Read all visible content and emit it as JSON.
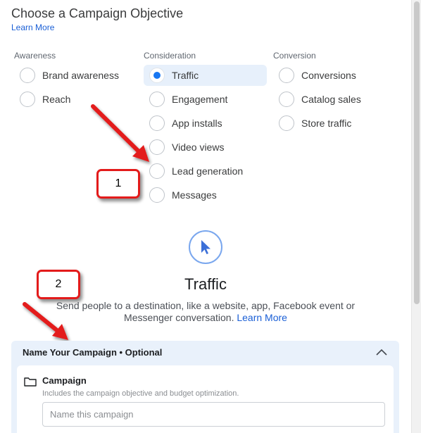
{
  "header": {
    "title": "Choose a Campaign Objective",
    "learn_more": "Learn More"
  },
  "columns": [
    {
      "header": "Awareness",
      "options": [
        "Brand awareness",
        "Reach"
      ]
    },
    {
      "header": "Consideration",
      "options": [
        "Traffic",
        "Engagement",
        "App installs",
        "Video views",
        "Lead generation",
        "Messages"
      ]
    },
    {
      "header": "Conversion",
      "options": [
        "Conversions",
        "Catalog sales",
        "Store traffic"
      ]
    }
  ],
  "selected_option": "Traffic",
  "callouts": {
    "one": "1",
    "two": "2"
  },
  "objective": {
    "icon": "cursor-pointer-icon",
    "title": "Traffic",
    "description": "Send people to a destination, like a website, app, Facebook event or Messenger conversation.",
    "learn_more": "Learn More"
  },
  "name_panel": {
    "title": "Name Your Campaign • Optional",
    "campaign_label": "Campaign",
    "campaign_desc": "Includes the campaign objective and budget optimization.",
    "input_placeholder": "Name this campaign",
    "input_value": ""
  },
  "colors": {
    "accent": "#1877f2",
    "link": "#1a5fd6",
    "callout_border": "#e31b1b",
    "selected_bg": "#e7f0fb",
    "panel_bg": "#e9f1fb"
  }
}
